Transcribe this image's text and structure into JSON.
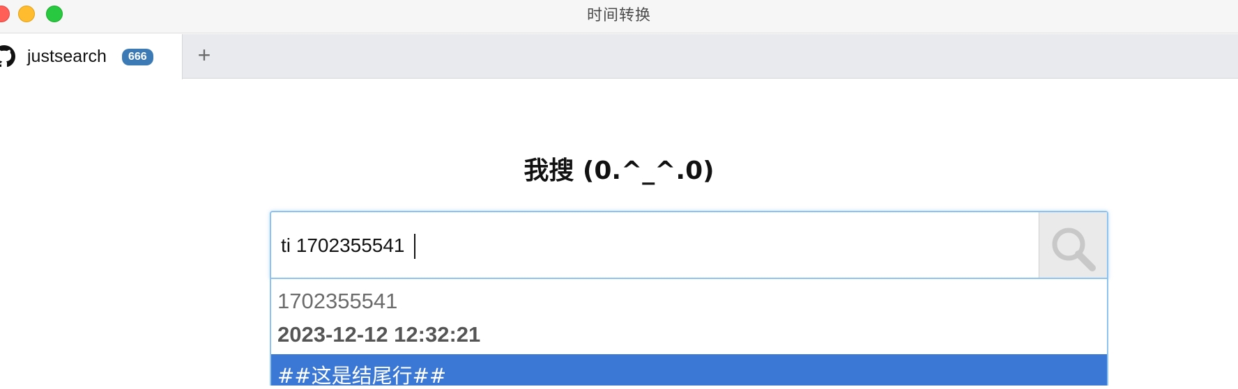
{
  "window": {
    "title": "时间转换"
  },
  "tabs": [
    {
      "label": "justsearch",
      "badge": "666"
    }
  ],
  "new_tab_label": "+",
  "heading": "我搜 (0.^_^.0)",
  "search": {
    "value": "ti 1702355541",
    "button_icon": "magnifier-icon"
  },
  "dropdown": {
    "result": {
      "input": "1702355541",
      "output": "2023-12-12 12:32:21"
    },
    "end_marker": "##这是结尾行##"
  },
  "colors": {
    "badge": "#3b7ab4",
    "highlight": "#3b77d4",
    "focus_border": "#8cc3f0"
  }
}
